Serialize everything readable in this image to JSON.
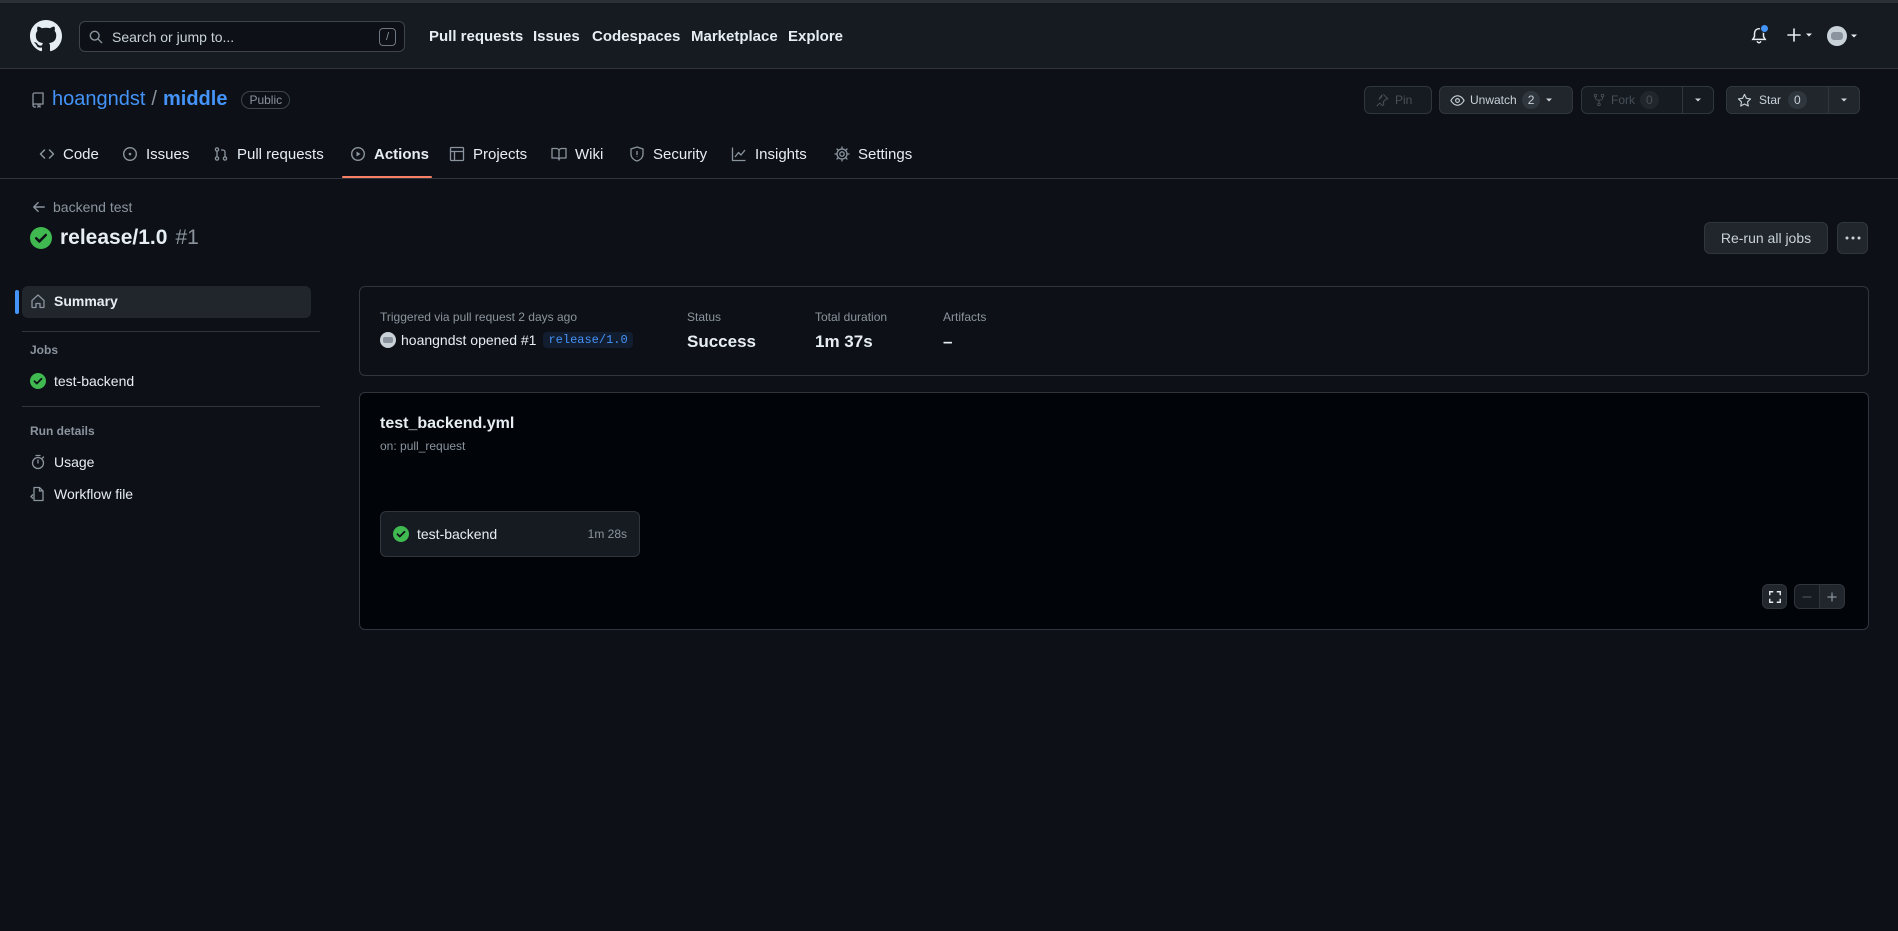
{
  "header": {
    "search_placeholder": "Search or jump to...",
    "search_shortcut": "/",
    "nav": [
      "Pull requests",
      "Issues",
      "Codespaces",
      "Marketplace",
      "Explore"
    ]
  },
  "repo": {
    "owner": "hoangndst",
    "separator": "/",
    "name": "middle",
    "visibility": "Public",
    "pin_label": "Pin",
    "unwatch_label": "Unwatch",
    "watch_count": "2",
    "fork_label": "Fork",
    "fork_count": "0",
    "star_label": "Star",
    "star_count": "0"
  },
  "tabs": [
    {
      "label": "Code",
      "icon": "code-icon"
    },
    {
      "label": "Issues",
      "icon": "issue-icon"
    },
    {
      "label": "Pull requests",
      "icon": "pull-request-icon"
    },
    {
      "label": "Actions",
      "icon": "play-icon",
      "active": true
    },
    {
      "label": "Projects",
      "icon": "table-icon"
    },
    {
      "label": "Wiki",
      "icon": "book-icon"
    },
    {
      "label": "Security",
      "icon": "shield-icon"
    },
    {
      "label": "Insights",
      "icon": "graph-icon"
    },
    {
      "label": "Settings",
      "icon": "gear-icon"
    }
  ],
  "run": {
    "back_label": "backend test",
    "branch": "release/1.0",
    "number": "#1",
    "rerun_label": "Re-run all jobs"
  },
  "sidebar": {
    "summary_label": "Summary",
    "jobs_heading": "Jobs",
    "job_label": "test-backend",
    "run_details_heading": "Run details",
    "usage_label": "Usage",
    "workflow_file_label": "Workflow file"
  },
  "summary": {
    "trigger_label": "Triggered via pull request 2 days ago",
    "actor_text": "hoangndst opened #1",
    "branch": "release/1.0",
    "status_label": "Status",
    "status_value": "Success",
    "duration_label": "Total duration",
    "duration_value": "1m 37s",
    "artifacts_label": "Artifacts",
    "artifacts_value": "–"
  },
  "workflow": {
    "file": "test_backend.yml",
    "trigger": "on: pull_request",
    "job_name": "test-backend",
    "job_duration": "1m 28s"
  },
  "colors": {
    "accent": "#4493f8",
    "success": "#3fb950",
    "active_tab_underline": "#f78166",
    "background": "#0d1117"
  }
}
